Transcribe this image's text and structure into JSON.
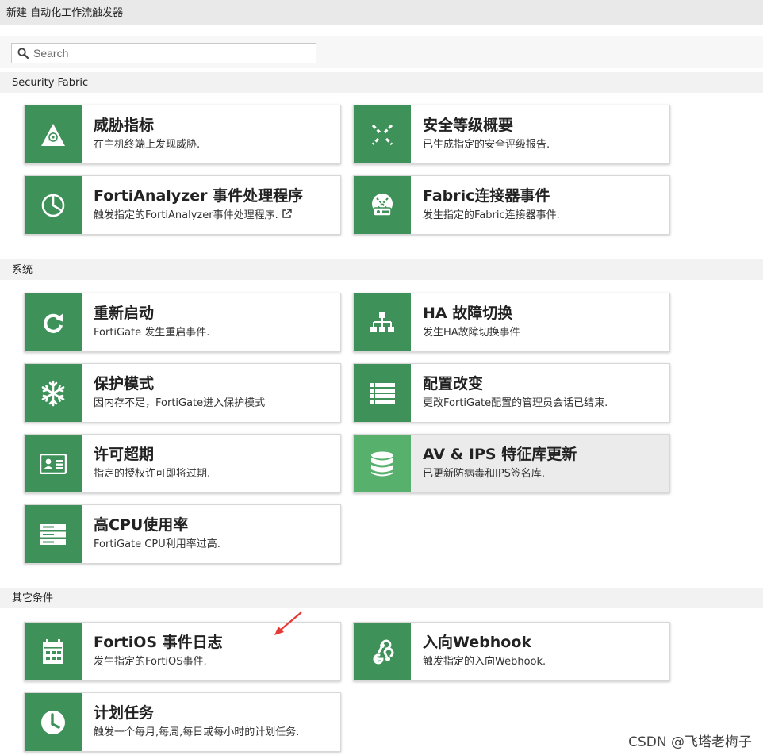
{
  "title": "新建 自动化工作流触发器",
  "search": {
    "placeholder": "Search"
  },
  "sections": {
    "fabric": {
      "label": "Security Fabric",
      "cards": [
        {
          "title": "威胁指标",
          "desc": "在主机终端上发现威胁."
        },
        {
          "title": "安全等级概要",
          "desc": "已生成指定的安全评级报告."
        },
        {
          "title": "FortiAnalyzer 事件处理程序",
          "desc": "触发指定的FortiAnalyzer事件处理程序."
        },
        {
          "title": "Fabric连接器事件",
          "desc": "发生指定的Fabric连接器事件."
        }
      ]
    },
    "system": {
      "label": "系统",
      "cards": [
        {
          "title": "重新启动",
          "desc": "FortiGate 发生重启事件."
        },
        {
          "title": "HA 故障切换",
          "desc": "发生HA故障切换事件"
        },
        {
          "title": "保护模式",
          "desc": "因内存不足，FortiGate进入保护模式"
        },
        {
          "title": "配置改变",
          "desc": "更改FortiGate配置的管理员会话已结束."
        },
        {
          "title": "许可超期",
          "desc": "指定的授权许可即将过期."
        },
        {
          "title": "AV & IPS 特征库更新",
          "desc": "已更新防病毒和IPS签名库."
        },
        {
          "title": "高CPU使用率",
          "desc": "FortiGate CPU利用率过高."
        }
      ]
    },
    "other": {
      "label": "其它条件",
      "cards": [
        {
          "title": "FortiOS 事件日志",
          "desc": "发生指定的FortiOS事件."
        },
        {
          "title": "入向Webhook",
          "desc": "触发指定的入向Webhook."
        },
        {
          "title": "计划任务",
          "desc": "触发一个每月,每周,每日或每小时的计划任务."
        }
      ]
    }
  },
  "watermark": "CSDN @飞塔老梅子",
  "colors": {
    "icon_bg": "#3e9158",
    "icon_bg_highlight": "#57b16d",
    "annotation_arrow": "#e53935"
  }
}
